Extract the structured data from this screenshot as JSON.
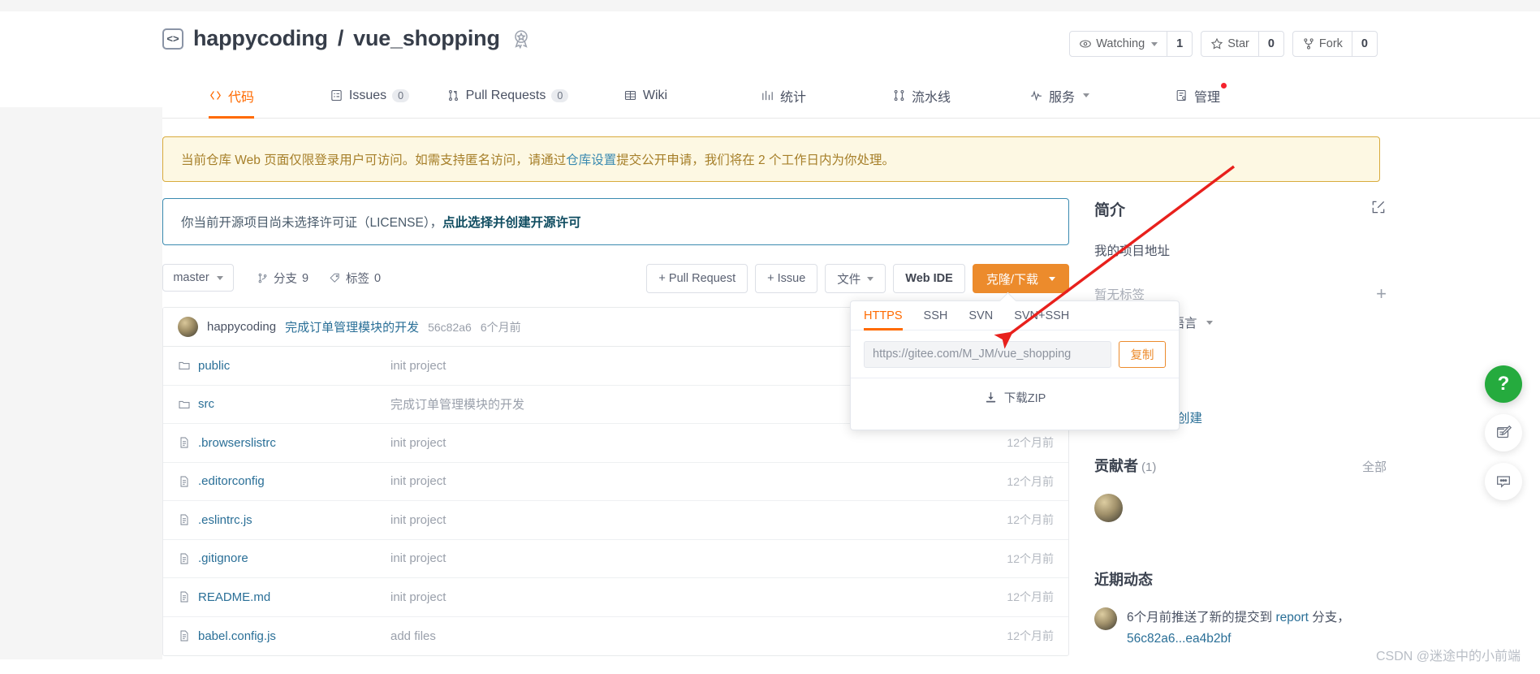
{
  "header": {
    "owner": "happycoding",
    "separator": "/",
    "repo": "vue_shopping",
    "repo_icon": "code-brackets-icon",
    "badge_icon": "award-badge-icon",
    "actions": [
      {
        "label": "Watching",
        "icon": "eye-icon",
        "count": "1",
        "has_caret": true
      },
      {
        "label": "Star",
        "icon": "star-icon",
        "count": "0",
        "has_caret": false
      },
      {
        "label": "Fork",
        "icon": "fork-icon",
        "count": "0",
        "has_caret": false
      }
    ]
  },
  "nav": {
    "tabs": [
      {
        "label": "代码",
        "icon": "code-icon",
        "count": null,
        "active": true,
        "caret": false,
        "dot": false
      },
      {
        "label": "Issues",
        "icon": "issues-icon",
        "count": "0",
        "active": false,
        "caret": false,
        "dot": false
      },
      {
        "label": "Pull Requests",
        "icon": "pull-request-icon",
        "count": "0",
        "active": false,
        "caret": false,
        "dot": false
      },
      {
        "label": "Wiki",
        "icon": "book-icon",
        "count": null,
        "active": false,
        "caret": false,
        "dot": false
      },
      {
        "label": "统计",
        "icon": "chart-icon",
        "count": null,
        "active": false,
        "caret": false,
        "dot": false
      },
      {
        "label": "流水线",
        "icon": "pipeline-icon",
        "count": null,
        "active": false,
        "caret": false,
        "dot": false
      },
      {
        "label": "服务",
        "icon": "activity-icon",
        "count": null,
        "active": false,
        "caret": true,
        "dot": false
      },
      {
        "label": "管理",
        "icon": "settings-icon",
        "count": null,
        "active": false,
        "caret": false,
        "dot": true
      }
    ]
  },
  "banners": {
    "warning": {
      "part1": "当前仓库 Web 页面仅限登录用户可访问。如需支持匿名访问，请通过 ",
      "link": "仓库设置",
      "part2": " 提交公开申请，我们将在 2 个工作日内为你处理。"
    },
    "license": {
      "text": "你当前开源项目尚未选择许可证（LICENSE），",
      "link": "点此选择并创建开源许可"
    }
  },
  "toolbar": {
    "branch": "master",
    "branches_label": "分支",
    "branches_count": "9",
    "tags_label": "标签",
    "tags_count": "0",
    "pull_request": "+ Pull Request",
    "issue": "+ Issue",
    "files": "文件",
    "web_ide": "Web IDE",
    "clone": "克隆/下载"
  },
  "clone_popover": {
    "tabs": [
      "HTTPS",
      "SSH",
      "SVN",
      "SVN+SSH"
    ],
    "active_tab": "HTTPS",
    "url": "https://gitee.com/M_JM/vue_shopping",
    "copy_label": "复制",
    "zip_label": "下载ZIP",
    "zip_icon": "download-icon"
  },
  "commit": {
    "author": "happycoding",
    "message": "完成订单管理模块的开发",
    "sha": "56c82a6",
    "time": "6个月前"
  },
  "files": [
    {
      "name": "public",
      "type": "folder",
      "message": "init project",
      "time": ""
    },
    {
      "name": "src",
      "type": "folder",
      "message": "完成订单管理模块的开发",
      "time": ""
    },
    {
      "name": ".browserslistrc",
      "type": "file",
      "message": "init project",
      "time": "12个月前"
    },
    {
      "name": ".editorconfig",
      "type": "file",
      "message": "init project",
      "time": "12个月前"
    },
    {
      "name": ".eslintrc.js",
      "type": "file",
      "message": "init project",
      "time": "12个月前"
    },
    {
      "name": ".gitignore",
      "type": "file",
      "message": "init project",
      "time": "12个月前"
    },
    {
      "name": "README.md",
      "type": "file",
      "message": "init project",
      "time": "12个月前"
    },
    {
      "name": "babel.config.js",
      "type": "file",
      "message": "add files",
      "time": "12个月前"
    }
  ],
  "sidebar": {
    "about_title": "简介",
    "edit_icon": "edit-square-icon",
    "description": "我的项目地址",
    "no_tags": "暂无标签",
    "add_tag_icon": "plus-icon",
    "languages": "种语言",
    "create_link": "创建",
    "contributors_title": "贡献者",
    "contributors_count": "(1)",
    "contributors_all": "全部",
    "recent_title": "近期动态",
    "recent_items": [
      {
        "prefix": "6个月前推送了新的提交到 ",
        "branch": "report",
        "middle": " 分支，",
        "sha": "56c82a6...ea4b2bf"
      }
    ]
  },
  "fabs": [
    {
      "icon": "help-question-icon",
      "style": "green"
    },
    {
      "icon": "edit-feedback-icon",
      "style": "white"
    },
    {
      "icon": "chat-bubble-icon",
      "style": "white"
    }
  ],
  "watermark": "CSDN @迷途中的小前端",
  "colors": {
    "accent": "#ff6a00",
    "clone_button": "#ec8b2c",
    "link": "#2a6f97",
    "warning_bg": "#fdf8e3",
    "warning_border": "#d8ab3d",
    "annotation_arrow": "#e8201c",
    "fab_green": "#25ab3e"
  }
}
